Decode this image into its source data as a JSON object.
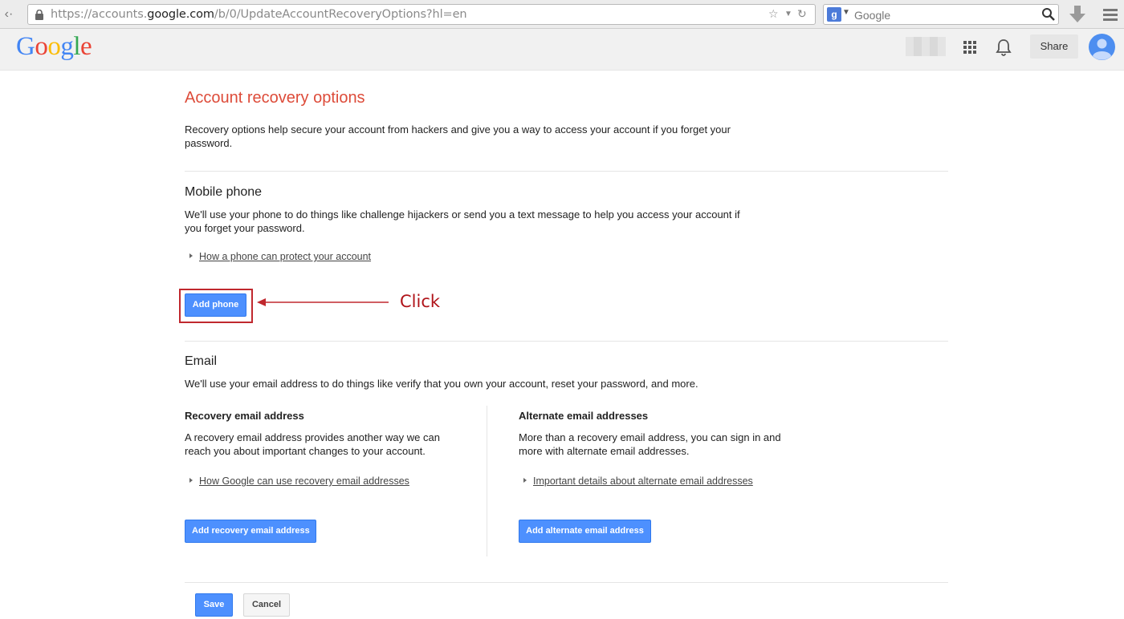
{
  "browser": {
    "url_prefix": "https://accounts.",
    "url_domain": "google.com",
    "url_suffix": "/b/0/UpdateAccountRecoveryOptions?hl=en",
    "search_engine_letter": "g",
    "search_placeholder": "Google"
  },
  "header": {
    "logo_letters": [
      "G",
      "o",
      "o",
      "g",
      "l",
      "e"
    ],
    "logo_colors": [
      "#4285f4",
      "#ea4335",
      "#fbbc05",
      "#4285f4",
      "#34a853",
      "#ea4335"
    ],
    "share_label": "Share"
  },
  "page": {
    "title": "Account recovery options",
    "intro": "Recovery options help secure your account from hackers and give you a way to access your account if you forget your password."
  },
  "mobile": {
    "title": "Mobile phone",
    "description": "We'll use your phone to do things like challenge hijackers or send you a text message to help you access your account if you forget your password.",
    "link": "How a phone can protect your account",
    "button": "Add phone"
  },
  "annotation": {
    "label": "Click",
    "color": "#c0282e"
  },
  "email": {
    "title": "Email",
    "description": "We'll use your email address to do things like verify that you own your account, reset your password, and more.",
    "recovery": {
      "title": "Recovery email address",
      "description": "A recovery email address provides another way we can reach you about important changes to your account.",
      "link": "How Google can use recovery email addresses",
      "button": "Add recovery email address"
    },
    "alternate": {
      "title": "Alternate email addresses",
      "description": "More than a recovery email address, you can sign in and more with alternate email addresses.",
      "link": "Important details about alternate email addresses",
      "button": "Add alternate email address"
    }
  },
  "footer": {
    "save": "Save",
    "cancel": "Cancel"
  },
  "colors": {
    "accent_title": "#dd4b39",
    "primary_button": "#4d90fe"
  }
}
